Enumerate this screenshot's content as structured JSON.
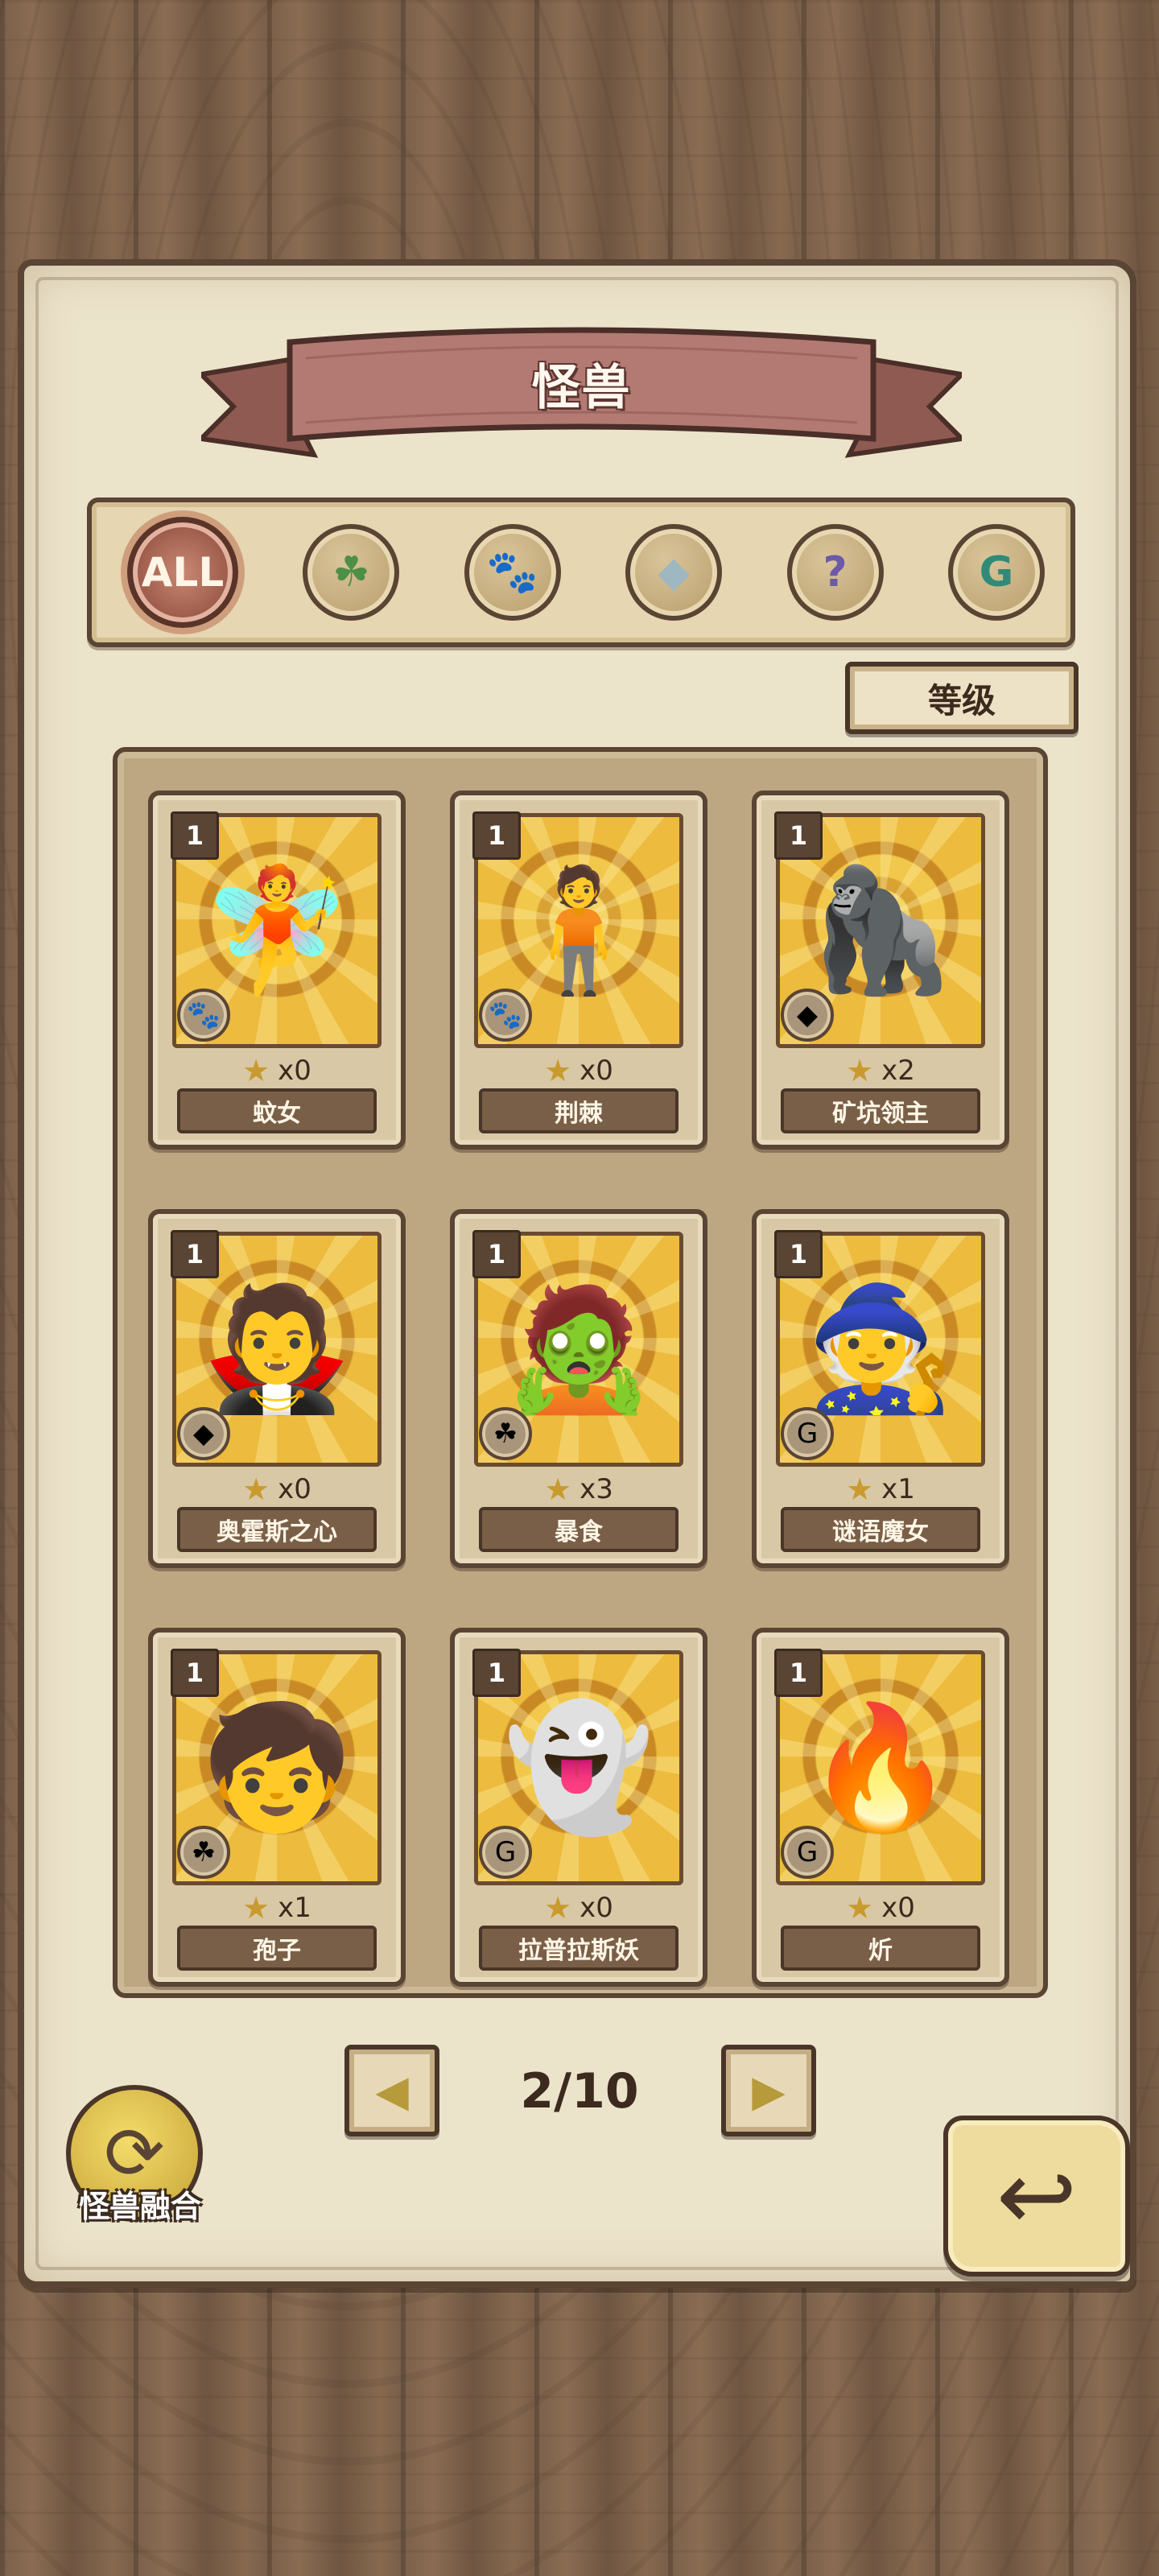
{
  "header": {
    "title": "怪兽"
  },
  "filters": [
    {
      "id": "all",
      "label": "ALL",
      "icon": "all-badge",
      "active": true
    },
    {
      "id": "plant",
      "label": "",
      "glyph": "☘",
      "icon": "leaf-icon"
    },
    {
      "id": "beast",
      "label": "",
      "glyph": "🐾",
      "icon": "paw-icon"
    },
    {
      "id": "mineral",
      "label": "",
      "glyph": "◆",
      "icon": "crystal-icon"
    },
    {
      "id": "unknown",
      "label": "",
      "glyph": "?",
      "icon": "question-icon"
    },
    {
      "id": "spirit",
      "label": "",
      "glyph": "G",
      "icon": "spiral-icon"
    }
  ],
  "sort": {
    "label": "等级"
  },
  "cards": [
    {
      "level": "1",
      "name": "蚊女",
      "count": "x0",
      "type_glyph": "🐾",
      "type_icon": "paw-icon",
      "creature": "🧚"
    },
    {
      "level": "1",
      "name": "荆棘",
      "count": "x0",
      "type_glyph": "🐾",
      "type_icon": "paw-icon",
      "creature": "🧍"
    },
    {
      "level": "1",
      "name": "矿坑领主",
      "count": "x2",
      "type_glyph": "◆",
      "type_icon": "crystal-icon",
      "creature": "🦍"
    },
    {
      "level": "1",
      "name": "奥霍斯之心",
      "count": "x0",
      "type_glyph": "◆",
      "type_icon": "crystal-icon",
      "creature": "🧛"
    },
    {
      "level": "1",
      "name": "暴食",
      "count": "x3",
      "type_glyph": "☘",
      "type_icon": "leaf-icon",
      "creature": "🧟"
    },
    {
      "level": "1",
      "name": "谜语魔女",
      "count": "x1",
      "type_glyph": "G",
      "type_icon": "spiral-icon",
      "creature": "🧙"
    },
    {
      "level": "1",
      "name": "孢子",
      "count": "x1",
      "type_glyph": "☘",
      "type_icon": "leaf-icon",
      "creature": "🧒"
    },
    {
      "level": "1",
      "name": "拉普拉斯妖",
      "count": "x0",
      "type_glyph": "G",
      "type_icon": "spiral-icon",
      "creature": "👻"
    },
    {
      "level": "1",
      "name": "炘",
      "count": "x0",
      "type_glyph": "G",
      "type_icon": "spiral-icon",
      "creature": "🔥"
    }
  ],
  "pager": {
    "current": "2/10",
    "prev_glyph": "◀",
    "next_glyph": "▶"
  },
  "fusion": {
    "label": "怪兽融合",
    "glyph": "⟳"
  },
  "back": {
    "glyph": "↩"
  },
  "colors": {
    "parchment": "#ece3cb",
    "border": "#5a4433",
    "ribbon": "#b27a73",
    "card_art": "#edbb3d"
  }
}
